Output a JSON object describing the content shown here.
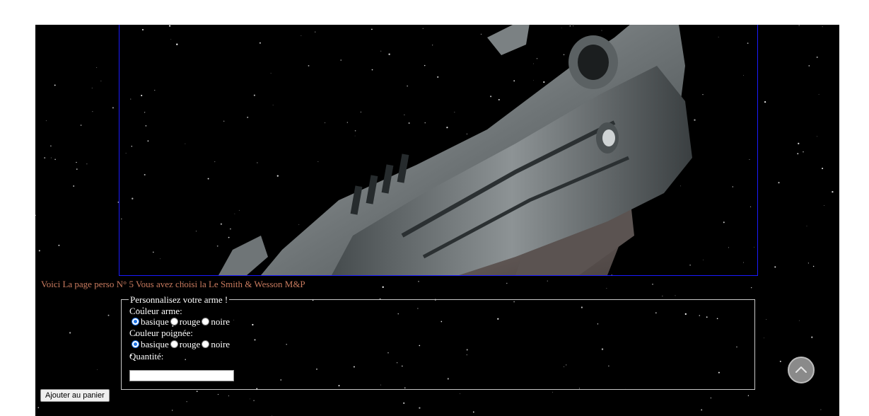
{
  "product": {
    "image_alt": "Smith & Wesson M&P",
    "intro_text": "Voici La page perso N° 5 Vous avez choisi la Le Smith & Wesson M&P"
  },
  "form": {
    "legend": "Personnalisez votre arme !",
    "weapon_color": {
      "label": "Couleur arme:",
      "options": [
        "basique",
        "rouge",
        "noire"
      ],
      "selected": "basique"
    },
    "grip_color": {
      "label": "Couleur poignée:",
      "options": [
        "basique",
        "rouge",
        "noire"
      ],
      "selected": "basique"
    },
    "quantity": {
      "label": "Quantité:",
      "value": ""
    },
    "submit_label": "Ajouter au panier"
  },
  "icons": {
    "scroll_top": "chevron-up-icon"
  },
  "colors": {
    "background": "#000000",
    "intro_text": "#c87a5e",
    "frame_border": "#1a1aff",
    "radio_accent": "#1a73e8"
  }
}
